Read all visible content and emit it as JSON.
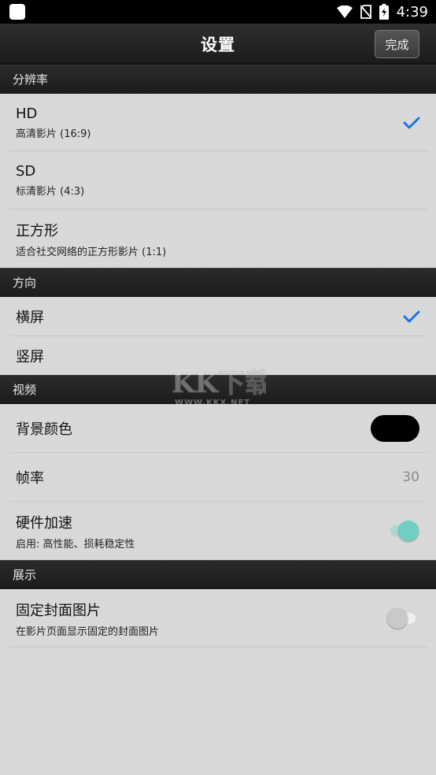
{
  "status_bar": {
    "time": "4:39"
  },
  "nav": {
    "title": "设置",
    "done_label": "完成"
  },
  "sections": {
    "resolution": {
      "header": "分辨率",
      "items": [
        {
          "title": "HD",
          "subtitle": "高清影片 (16:9)",
          "checked": true
        },
        {
          "title": "SD",
          "subtitle": "标清影片 (4:3)",
          "checked": false
        },
        {
          "title": "正方形",
          "subtitle": "适合社交网络的正方形影片 (1:1)",
          "checked": false
        }
      ]
    },
    "orientation": {
      "header": "方向",
      "items": [
        {
          "title": "横屏",
          "checked": true
        },
        {
          "title": "竖屏",
          "checked": false
        }
      ]
    },
    "video": {
      "header": "视频",
      "background_color": {
        "title": "背景颜色",
        "color": "#000000"
      },
      "frame_rate": {
        "title": "帧率",
        "value": "30"
      },
      "hardware_accel": {
        "title": "硬件加速",
        "subtitle": "启用: 高性能、损耗稳定性",
        "enabled": true
      }
    },
    "display": {
      "header": "展示",
      "fixed_cover": {
        "title": "固定封面图片",
        "subtitle": "在影片页面显示固定的封面图片",
        "enabled": false
      }
    }
  },
  "watermark": {
    "text": "WWW.KKX.NET"
  },
  "colors": {
    "accent_check": "#1a73e8",
    "toggle_on": "#70cfc3",
    "toggle_off": "#c9c9c9"
  }
}
